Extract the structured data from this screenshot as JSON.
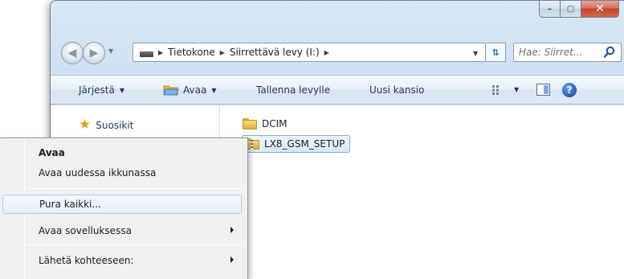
{
  "window": {
    "controls": {
      "minimize": "–",
      "maximize": "▢",
      "close": "✕"
    }
  },
  "address": {
    "crumbs": [
      "Tietokone",
      "Siirrettävä levy (I:)"
    ],
    "search_placeholder": "Hae: Siirret..."
  },
  "toolbar": {
    "organize": "Järjestä",
    "open": "Avaa",
    "burn": "Tallenna levylle",
    "new_folder": "Uusi kansio",
    "help": "?"
  },
  "nav_pane": {
    "favorites": "Suosikit"
  },
  "files": [
    {
      "name": "DCIM",
      "icon": "folder-icon"
    },
    {
      "name": "LX8_GSM_SETUP",
      "icon": "zip-folder-icon",
      "selected": true
    }
  ],
  "context_menu": {
    "items": [
      {
        "label": "Avaa",
        "bold": true
      },
      {
        "label": "Avaa uudessa ikkunassa"
      },
      {
        "label": "Pura kaikki...",
        "highlighted": true
      },
      {
        "label": "Avaa sovelluksessa",
        "submenu": true
      },
      {
        "label": "Lähetä kohteeseen:",
        "submenu": true
      }
    ]
  },
  "colors": {
    "frame": "#c8dcf0",
    "command_bar_text": "#1e395b",
    "selection_border": "#84acdd",
    "close_button": "#c5442a"
  }
}
